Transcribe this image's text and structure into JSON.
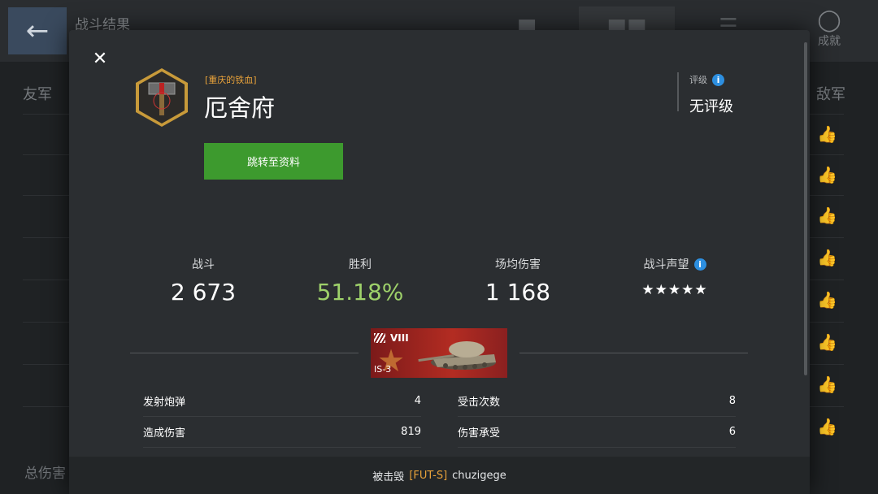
{
  "background": {
    "title": "战斗结果",
    "back_icon": "arrow-left",
    "achievements_label": "成就",
    "allies_label": "友军",
    "enemies_label": "敌军",
    "total_damage_label": "总伤害"
  },
  "modal": {
    "clan_tag": "[重庆的铁血]",
    "player_name": "厄舍府",
    "rating_label": "评级",
    "rating_value": "无评级",
    "profile_button": "跳转至资料",
    "stats": [
      {
        "label": "战斗",
        "value": "2 673"
      },
      {
        "label": "胜利",
        "value": "51.18%"
      },
      {
        "label": "场均伤害",
        "value": "1 168"
      },
      {
        "label": "战斗声望",
        "value": "★★★★★"
      }
    ],
    "tank": {
      "tier": "VIII",
      "name": "IS-3"
    },
    "details_left": [
      {
        "label": "发射炮弹",
        "value": "4"
      },
      {
        "label": "造成伤害",
        "value": "819"
      }
    ],
    "details_right": [
      {
        "label": "受击次数",
        "value": "8"
      },
      {
        "label": "伤害承受",
        "value": "6"
      }
    ],
    "killed_by_label": "被击毁",
    "killed_by_tag": "[FUT-S]",
    "killed_by_name": "chuzigege"
  },
  "colors": {
    "accent_green": "#3d9a2e",
    "win_rate_green": "#9ed16a",
    "clan_orange": "#e8a23a",
    "info_blue": "#2d8fe0"
  }
}
